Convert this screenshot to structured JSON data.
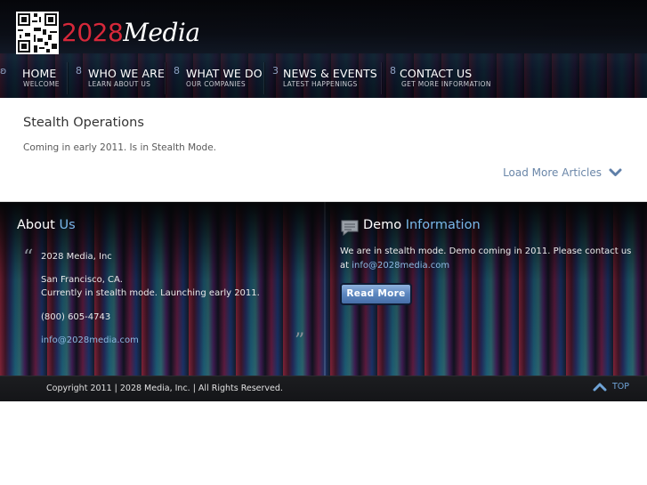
{
  "brand": {
    "number": "2028",
    "word": "Media"
  },
  "nav": [
    {
      "label": "HOME",
      "sub": "WELCOME",
      "glyph": "ʚ"
    },
    {
      "label": "WHO WE ARE",
      "sub": "LEARN ABOUT US",
      "glyph": "8"
    },
    {
      "label": "WHAT WE DO",
      "sub": "OUR COMPANIES",
      "glyph": "8"
    },
    {
      "label": "NEWS & EVENTS",
      "sub": "LATEST HAPPENINGS",
      "glyph": "3"
    },
    {
      "label": "CONTACT US",
      "sub": "GET MORE INFORMATION",
      "glyph": "8"
    }
  ],
  "article": {
    "title": "Stealth Operations",
    "body": "Coming in early 2011. Is in Stealth Mode."
  },
  "load_more": {
    "label": "Load More Articles",
    "icon": "chevron-down-icon"
  },
  "about": {
    "title_plain": "About",
    "title_accent": "Us",
    "company": "2028 Media, Inc",
    "city": "San Francisco, CA.",
    "status": "Currently in stealth mode. Launching early 2011.",
    "phone": "(800) 605-4743",
    "email": "info@2028media.com"
  },
  "demo": {
    "title_plain": "Demo",
    "title_accent": "Information",
    "text": "We are in stealth mode. Demo coming in 2011. Please contact us at",
    "email": "info@2028media.com",
    "button": "Read More",
    "icon": "speech-bubble-icon"
  },
  "footer": {
    "copyright": "Copyright 2011 | 2028 Media, Inc. | All Rights Reserved.",
    "top_label": "TOP"
  },
  "colors": {
    "brand_red": "#d6283a",
    "accent_blue": "#7ab8ea",
    "link_blue": "#6a86a8"
  }
}
